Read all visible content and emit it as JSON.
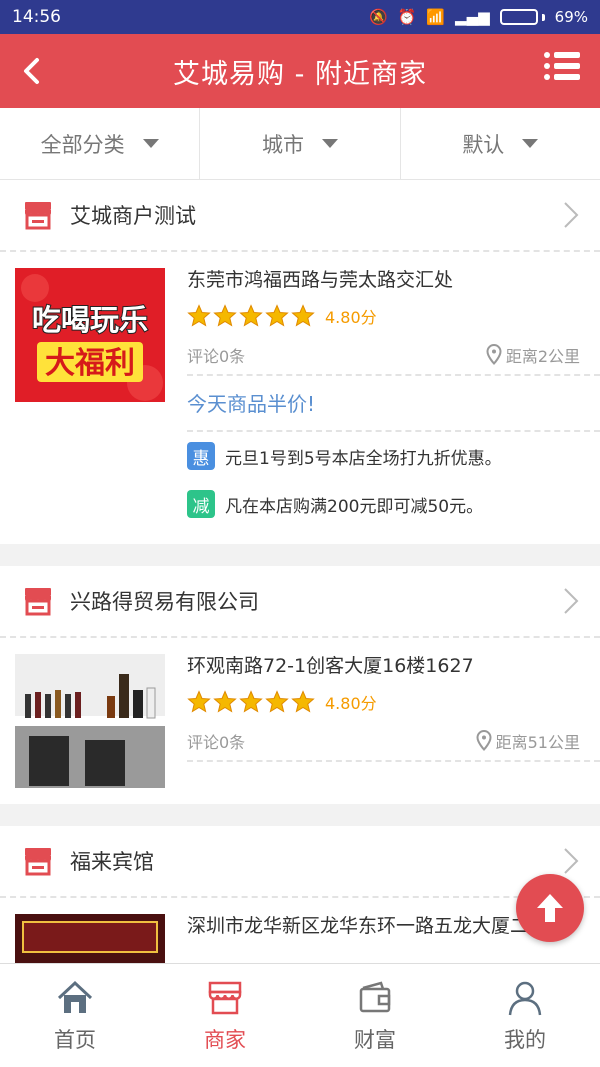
{
  "status_bar": {
    "time": "14:56",
    "battery": "69%"
  },
  "header": {
    "title": "艾城易购 - 附近商家"
  },
  "filters": [
    {
      "label": "全部分类"
    },
    {
      "label": "城市"
    },
    {
      "label": "默认"
    }
  ],
  "merchants": [
    {
      "name": "艾城商户测试",
      "address": "东莞市鸿福西路与莞太路交汇处",
      "rating": 5,
      "score": "4.80分",
      "reviews": "评论0条",
      "distance": "距离2公里",
      "thumb_text": [
        "吃喝玩乐",
        "大福利"
      ],
      "promo": "今天商品半价!",
      "deals": [
        {
          "tag": "惠",
          "color": "#4a8fe0",
          "text": "元旦1号到5号本店全场打九折优惠。"
        },
        {
          "tag": "减",
          "color": "#2dc48a",
          "text": "凡在本店购满200元即可减50元。"
        }
      ]
    },
    {
      "name": "兴路得贸易有限公司",
      "address": "环观南路72-1创客大厦16楼1627",
      "rating": 5,
      "score": "4.80分",
      "reviews": "评论0条",
      "distance": "距离51公里"
    },
    {
      "name": "福来宾馆",
      "address": "深圳市龙华新区龙华东环一路五龙大厦二"
    }
  ],
  "tabs": [
    {
      "label": "首页",
      "icon": "home-icon"
    },
    {
      "label": "商家",
      "icon": "store-icon"
    },
    {
      "label": "财富",
      "icon": "wallet-icon"
    },
    {
      "label": "我的",
      "icon": "user-icon"
    }
  ],
  "colors": {
    "brand": "#e24c52",
    "status_bar": "#2f3a8f",
    "star": "#f5b800",
    "score": "#f59b00"
  }
}
